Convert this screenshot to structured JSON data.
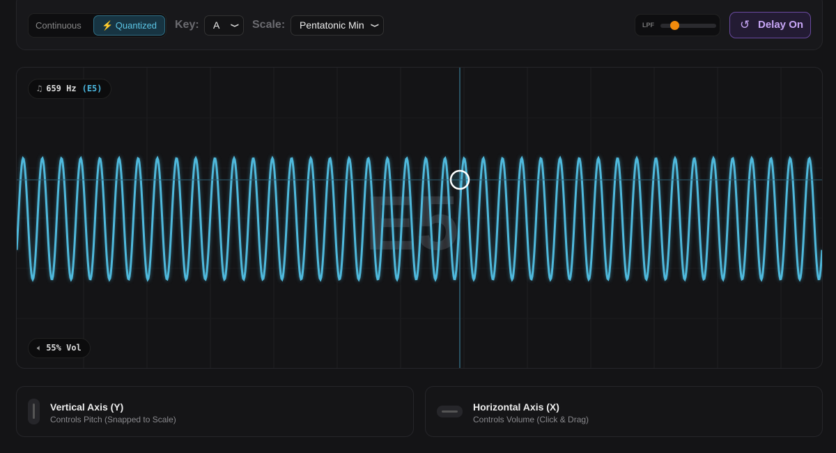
{
  "toolbar": {
    "mode_continuous": "Continuous",
    "mode_quantized": "Quantized",
    "key_label": "Key:",
    "key_value": "A",
    "scale_label": "Scale:",
    "scale_value": "Pentatonic Min",
    "lpf_label": "LPF",
    "lpf_value": 0.25,
    "delay_label": "Delay On"
  },
  "stage": {
    "frequency": "659 Hz",
    "note": "(E5)",
    "big_note": "E5",
    "volume": "55% Vol",
    "wave_color": "#4fb9dc",
    "cycles": 42
  },
  "cards": [
    {
      "title": "Vertical Axis (Y)",
      "subtitle": "Controls Pitch (Snapped to Scale)"
    },
    {
      "title": "Horizontal Axis (X)",
      "subtitle": "Controls Volume (Click & Drag)"
    }
  ]
}
